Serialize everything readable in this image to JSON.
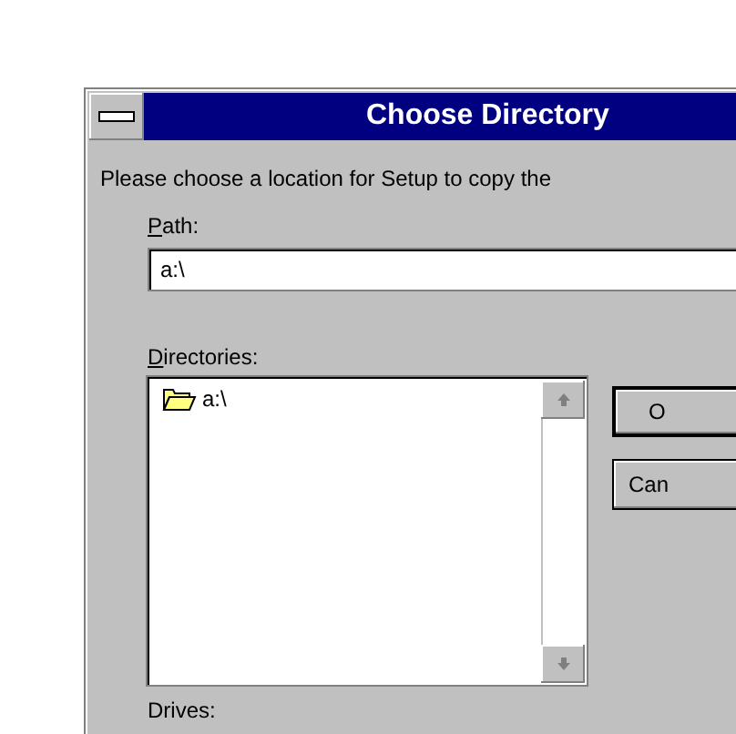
{
  "window": {
    "title": "Choose Directory"
  },
  "prompt": "Please choose a location for Setup to copy the",
  "path": {
    "label": {
      "key": "P",
      "rest": "ath:"
    },
    "value": "a:\\"
  },
  "directories": {
    "label": {
      "key": "D",
      "rest": "irectories:"
    },
    "items": [
      {
        "name": "a:\\",
        "selected": false
      }
    ]
  },
  "buttons": [
    {
      "label": "O",
      "default": true
    },
    {
      "label": "Can",
      "default": false
    }
  ],
  "drives": {
    "label": "Drives:"
  }
}
